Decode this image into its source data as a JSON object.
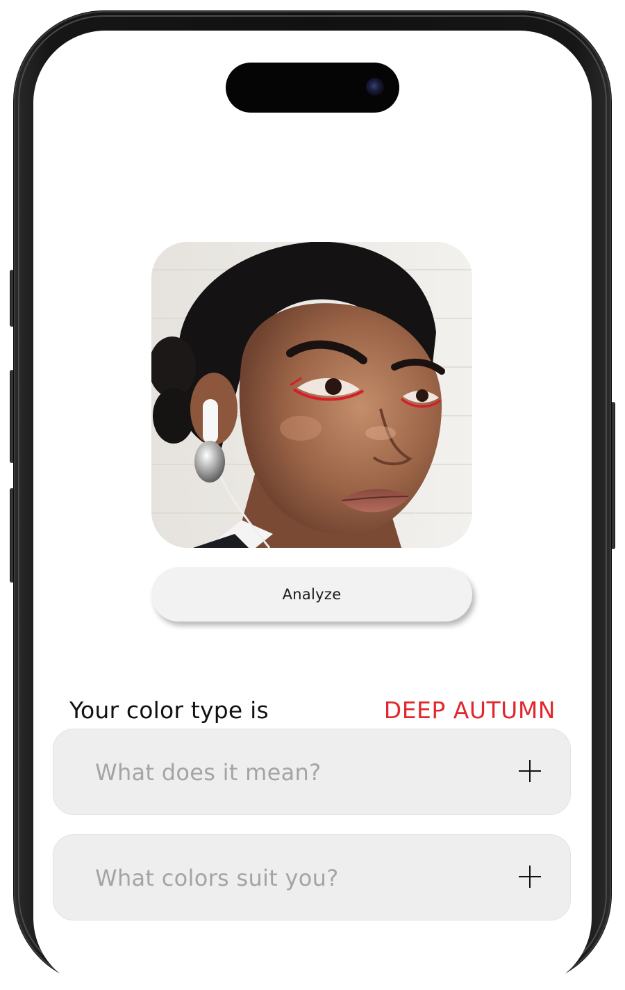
{
  "photo": {
    "subject": "portrait of a woman with red eyeliner and white earbuds"
  },
  "analyze_button": {
    "label": "Analyze"
  },
  "result": {
    "label": "Your color type is",
    "value": "DEEP AUTUMN",
    "value_color": "#e0282e"
  },
  "accordions": [
    {
      "title": "What does it mean?",
      "icon": "plus-icon"
    },
    {
      "title": "What colors suit you?",
      "icon": "plus-icon"
    }
  ],
  "colors": {
    "card_background": "#eeeeee",
    "button_background": "#f2f2f2",
    "accent": "#e0282e",
    "muted_text": "#a4a4a4"
  }
}
